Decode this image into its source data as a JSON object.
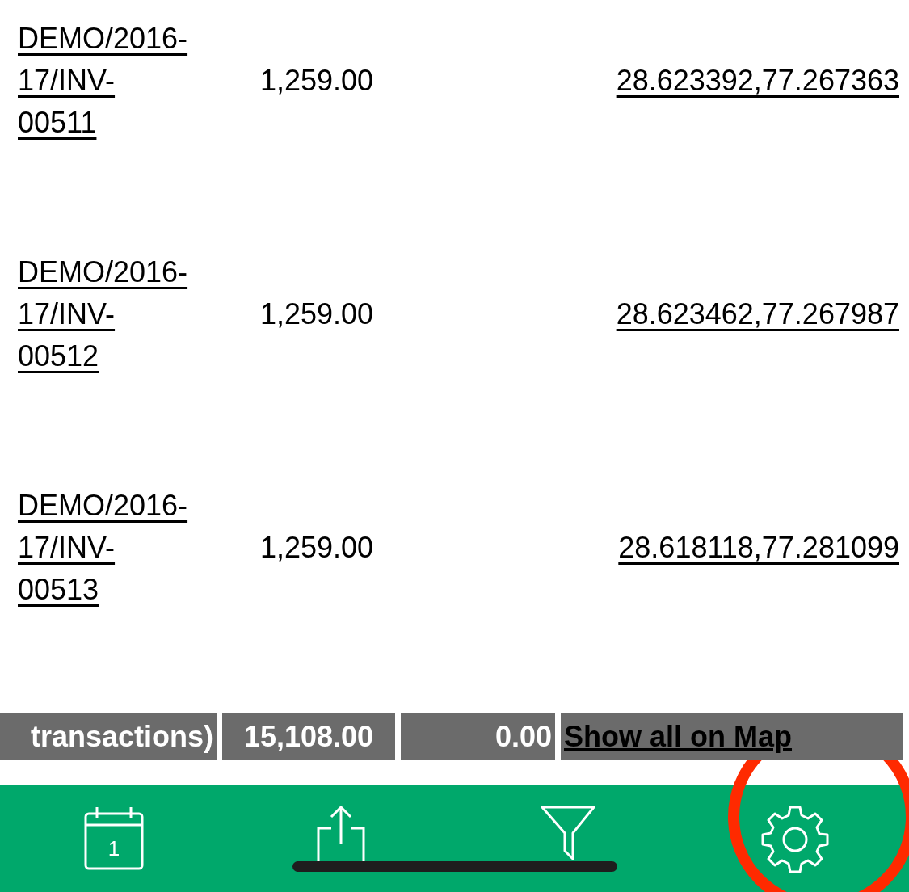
{
  "rows": [
    {
      "invoice": [
        "DEMO/2016-",
        "17/INV-",
        "00511"
      ],
      "amount": "1,259.00",
      "location": "28.623392,77.267363"
    },
    {
      "invoice": [
        "DEMO/2016-",
        "17/INV-",
        "00512"
      ],
      "amount": "1,259.00",
      "location": "28.623462,77.267987"
    },
    {
      "invoice": [
        "DEMO/2016-",
        "17/INV-",
        "00513"
      ],
      "amount": "1,259.00",
      "location": "28.618118,77.281099"
    }
  ],
  "totals": {
    "label": "transactions)",
    "amount": "15,108.00",
    "column_3": "0.00",
    "map_link": "Show all on Map"
  },
  "tab_bar": {
    "calendar_day": "1",
    "items": [
      {
        "kind": "calendar"
      },
      {
        "kind": "share"
      },
      {
        "kind": "filter"
      },
      {
        "kind": "settings"
      }
    ]
  },
  "annotation": {
    "kind": "circle",
    "color": "#ff2a00"
  }
}
